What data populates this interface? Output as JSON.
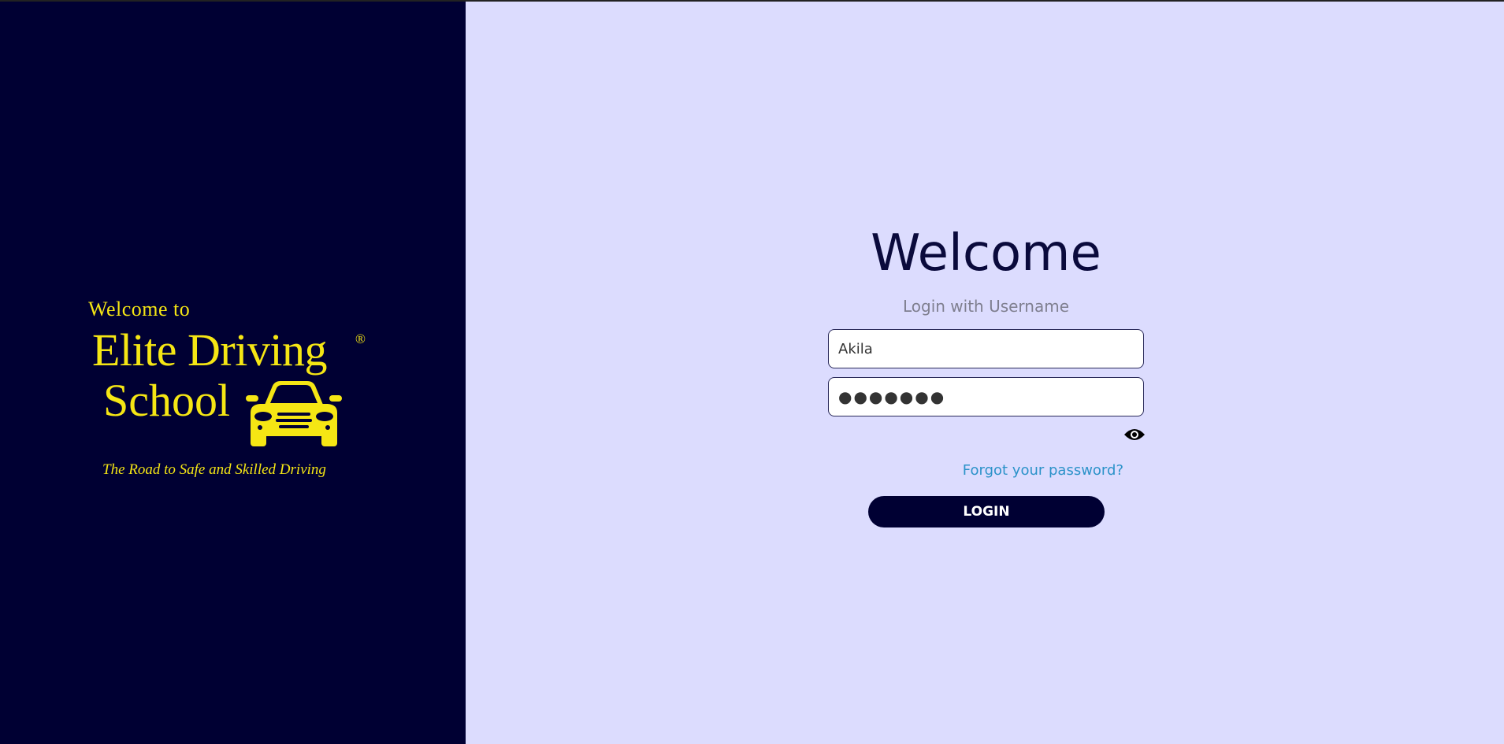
{
  "logo": {
    "welcome": "Welcome  to",
    "brand_line1": "Elite Driving",
    "registered": "®",
    "brand_line2": "School",
    "tagline": "The Road to Safe and Skilled Driving",
    "icon": "car-icon",
    "color": "#f5e614"
  },
  "login": {
    "title": "Welcome",
    "subtitle": "Login with Username",
    "username_value": "Akila",
    "password_value": "●●●●●●●",
    "password_toggle_icon": "eye-icon",
    "forgot_password_label": "Forgot your password?",
    "login_button_label": "LOGIN"
  },
  "colors": {
    "left_panel": "#000033",
    "right_panel": "#dcdcfe",
    "title": "#0a0a3c",
    "link": "#2b92c9",
    "button": "#000033"
  }
}
